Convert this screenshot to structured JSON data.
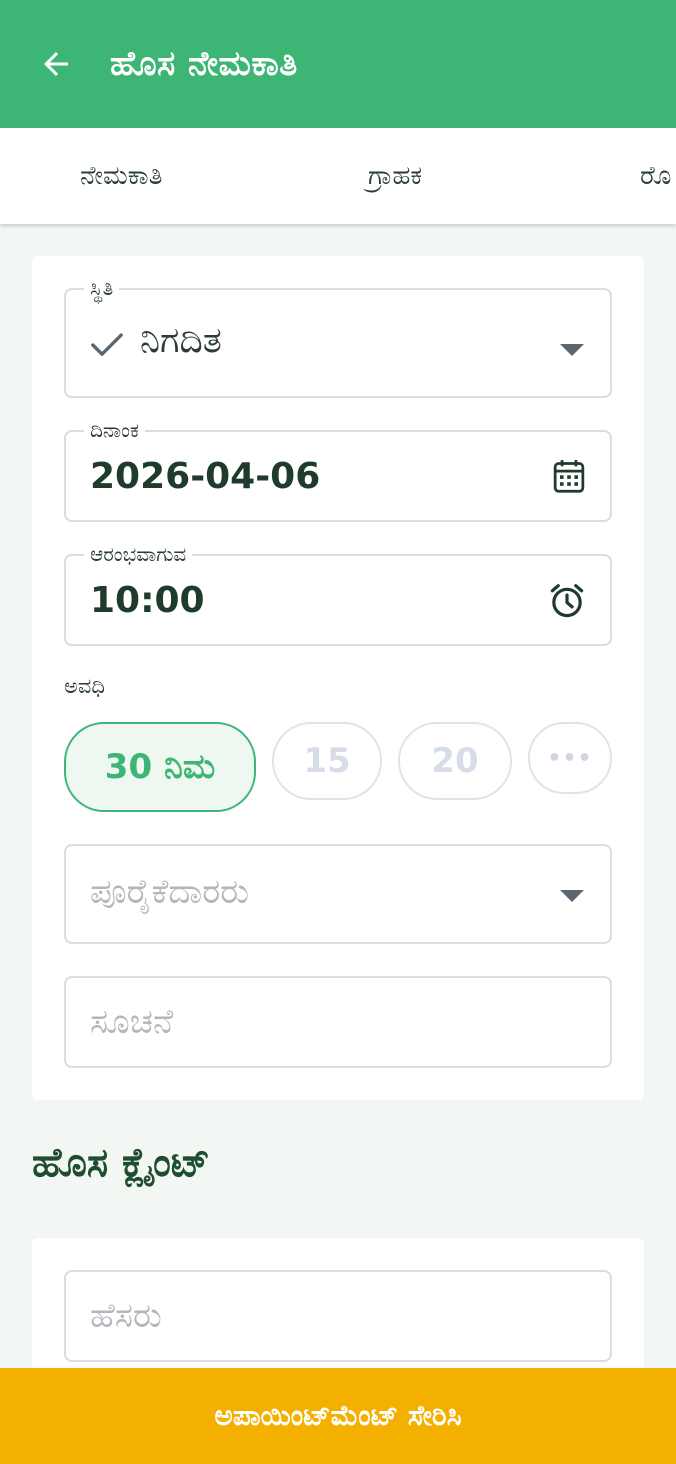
{
  "appbar": {
    "title": "ಹೊಸ ನೇಮಕಾತಿ"
  },
  "tabs": [
    {
      "label": "ನೇಮಕಾತಿ"
    },
    {
      "label": "ಗ್ರಾಹಕ"
    },
    {
      "label": "ರೊ"
    }
  ],
  "form": {
    "status": {
      "label": "ಸ್ಥಿತಿ",
      "value": "ನಿಗದಿತ"
    },
    "date": {
      "label": "ದಿನಾಂಕ",
      "value": "2026-04-06"
    },
    "start": {
      "label": "ಆರಂಭವಾಗುವ",
      "value": "10:00"
    },
    "duration": {
      "label": "ಅವಧಿ",
      "chips": [
        {
          "label": "30 ನಿಮ"
        },
        {
          "label": "15"
        },
        {
          "label": "20"
        },
        {
          "label": "•••"
        }
      ]
    },
    "supplier": {
      "placeholder": "ಪೂರೈಕೆದಾರರು"
    },
    "note": {
      "placeholder": "ಸೂಚನೆ"
    }
  },
  "new_client": {
    "title": "ಹೊಸ ಕ್ಲೈಂಟ್",
    "name_placeholder": "ಹೆಸರು"
  },
  "submit": {
    "label": "ಅಪಾಯಿಂಟ್‌ಮೆಂಟ್ ಸೇರಿಸಿ"
  },
  "colors": {
    "primary": "#3db574",
    "accent": "#f4b000",
    "chip_selected_bg": "#eef8f1"
  }
}
